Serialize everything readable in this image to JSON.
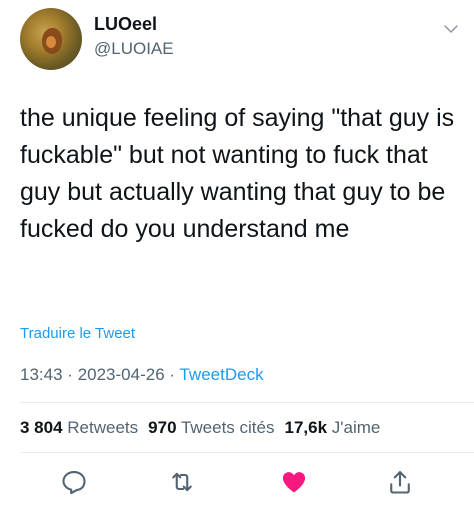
{
  "user": {
    "display_name": "LUOeel",
    "handle": "@LUOIAE"
  },
  "tweet": {
    "text": "the unique feeling of saying \"that guy is fuckable\" but not wanting to fuck that guy but actually wanting that guy to be fucked do you understand me",
    "translate_label": "Traduire le Tweet",
    "time": "13:43",
    "date": "2023-04-26",
    "separator": "·",
    "source": "TweetDeck"
  },
  "stats": {
    "retweets_count": "3 804",
    "retweets_label": "Retweets",
    "quotes_count": "970",
    "quotes_label": "Tweets cités",
    "likes_count": "17,6k",
    "likes_label": "J'aime"
  },
  "actions": {
    "reply_icon": "reply-icon",
    "retweet_icon": "retweet-icon",
    "like_icon": "heart-icon",
    "share_icon": "share-icon",
    "like_color": "#f91880",
    "icon_color": "#536471"
  },
  "colors": {
    "link": "#1d9bf0",
    "text": "#0f1419",
    "muted": "#536471"
  }
}
